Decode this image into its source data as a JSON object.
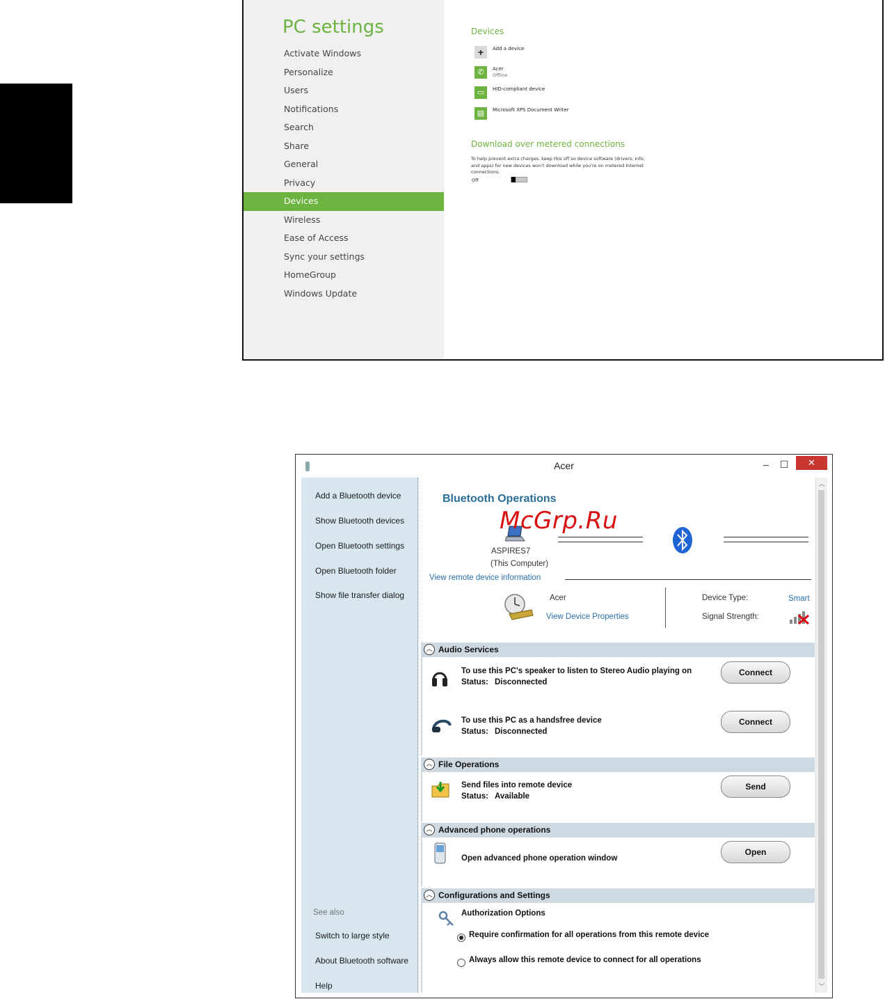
{
  "pc_settings": {
    "title": "PC settings",
    "nav_items": [
      "Activate Windows",
      "Personalize",
      "Users",
      "Notifications",
      "Search",
      "Share",
      "General",
      "Privacy",
      "Devices",
      "Wireless",
      "Ease of Access",
      "Sync your settings",
      "HomeGroup",
      "Windows Update"
    ],
    "active_item": "Devices",
    "devices_heading": "Devices",
    "devices": [
      {
        "name": "Add a device",
        "status": ""
      },
      {
        "name": "Acer",
        "status": "Offline"
      },
      {
        "name": "HID-compliant device",
        "status": ""
      },
      {
        "name": "Microsoft XPS Document Writer",
        "status": ""
      }
    ],
    "metered_heading": "Download over metered connections",
    "metered_desc": "To help prevent extra charges, keep this off so device software (drivers, info, and apps) for new devices won't download while you're on metered Internet connections.",
    "toggle_label": "Off",
    "accent_color": "#6db33f"
  },
  "bt_window": {
    "title": "Acer",
    "window_buttons": {
      "minimize": "–",
      "maximize": "☐",
      "close": "✕"
    },
    "sidebar": {
      "links": [
        "Add a Bluetooth device",
        "Show Bluetooth devices",
        "Open Bluetooth settings",
        "Open Bluetooth folder",
        "Show file transfer dialog"
      ],
      "see_also": "See also",
      "bottom_links": [
        "Switch to large style",
        "About Bluetooth software",
        "Help"
      ]
    },
    "heading": "Bluetooth Operations",
    "watermark": "McGrp.Ru",
    "computer_name": "ASPIRES7",
    "computer_sub": "(This Computer)",
    "view_remote": "View remote device information",
    "device_name": "Acer",
    "view_props": "View Device Properties",
    "device_type_label": "Device Type:",
    "device_type_value": "Smart",
    "signal_label": "Signal Strength:",
    "sections": {
      "audio": {
        "title": "Audio Services",
        "rows": [
          {
            "text": "To use this PC's speaker to listen to Stereo Audio playing on",
            "status_label": "Status:",
            "status": "Disconnected",
            "button": "Connect"
          },
          {
            "text": "To use this PC as a handsfree device",
            "status_label": "Status:",
            "status": "Disconnected",
            "button": "Connect"
          }
        ]
      },
      "file": {
        "title": "File Operations",
        "text": "Send files into remote device",
        "status_label": "Status:",
        "status": "Available",
        "button": "Send"
      },
      "phone": {
        "title": "Advanced phone operations",
        "text": "Open advanced phone operation window",
        "button": "Open"
      },
      "config": {
        "title": "Configurations and Settings",
        "auth": "Authorization Options",
        "opt1": "Require confirmation for all operations from this remote device",
        "opt2": "Always allow this remote device to connect for all operations",
        "selected": "opt1"
      }
    },
    "colors": {
      "sidebar": "#d7e6ef",
      "section_bar": "#cfd9e2",
      "link": "#2a6ea8",
      "heading": "#2a6e98",
      "close": "#c7372f",
      "watermark": "#d81010"
    }
  }
}
